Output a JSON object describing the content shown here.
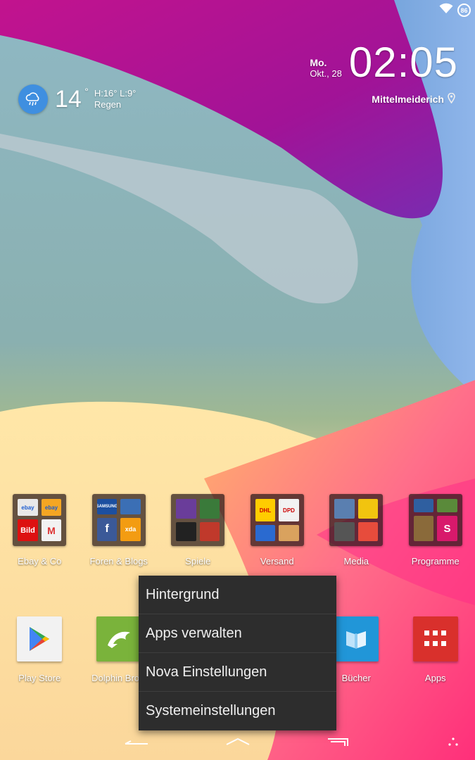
{
  "status_bar": {
    "icons": [
      "wifi-icon",
      "battery-icon"
    ],
    "battery_level": "86"
  },
  "clock_widget": {
    "day": "Mo.",
    "date": "Okt., 28",
    "time": "02:05",
    "location": "Mittelmeiderich"
  },
  "weather_widget": {
    "icon": "rain-cloud-icon",
    "temperature": "14",
    "degree_symbol": "°",
    "high_low": "H:16° L:9°",
    "condition": "Regen"
  },
  "folders": [
    {
      "label": "Ebay & Co",
      "minis": [
        "ebay",
        "ebay",
        "Bild",
        "M"
      ]
    },
    {
      "label": "Foren & Blogs",
      "minis": [
        "SAMSUNG",
        "",
        "f",
        "xda"
      ]
    },
    {
      "label": "Spiele",
      "minis": [
        "",
        "",
        "",
        ""
      ]
    },
    {
      "label": "Versand",
      "minis": [
        "DHL",
        "DPD",
        "",
        ""
      ]
    },
    {
      "label": "Media",
      "minis": [
        "",
        "",
        "",
        ""
      ]
    },
    {
      "label": "Programme",
      "minis": [
        "",
        "",
        "",
        "S"
      ]
    }
  ],
  "dock": [
    {
      "label": "Play Store",
      "icon": "play-store-icon"
    },
    {
      "label": "Dolphin Brow",
      "icon": "dolphin-icon"
    },
    {
      "label": "",
      "icon": ""
    },
    {
      "label": "",
      "icon": ""
    },
    {
      "label": "Bücher",
      "icon": "book-icon"
    },
    {
      "label": "Apps",
      "icon": "app-drawer-icon"
    }
  ],
  "context_menu": {
    "items": [
      "Hintergrund",
      "Apps verwalten",
      "Nova Einstellungen",
      "Systemeinstellungen"
    ]
  },
  "navigation": {
    "buttons": [
      "back-icon",
      "home-icon",
      "recent-apps-icon",
      "more-dots-icon"
    ]
  },
  "colors": {
    "menu_background": "#2d2d2d",
    "weather_accent": "#3f8fe0",
    "apps_red": "#d9302c",
    "dolphin_green": "#7ab33b",
    "books_blue": "#2196d8"
  }
}
